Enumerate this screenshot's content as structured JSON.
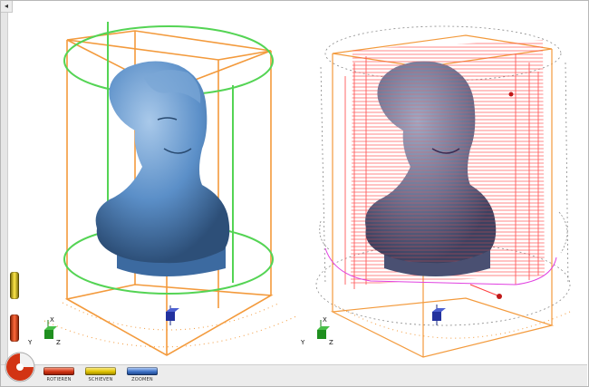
{
  "window": {
    "collapse_glyph": "◂"
  },
  "viewport": {
    "left_scene": {
      "object": "bust-model",
      "bounding_shape": "cylinder",
      "box_color": "#f39a3c",
      "cylinder_color": "#54d454"
    },
    "right_scene": {
      "object": "bust-model-toolpath",
      "toolpath_color": "#ff4040",
      "retract_color": "#e040e0"
    },
    "axis_triad": {
      "x": "X",
      "y": "Y",
      "z": "Z"
    }
  },
  "toolbar": {
    "buttons": [
      {
        "label": "ROTIEREN",
        "color": "#d23414"
      },
      {
        "label": "SCHIEVEN",
        "color": "#e2c400"
      },
      {
        "label": "ZOOMEN",
        "color": "#3e73c8"
      }
    ]
  },
  "side_controls": [
    {
      "name": "yellow-toggle",
      "color": "#ffe84a"
    },
    {
      "name": "red-toggle",
      "color": "#ff6a3c"
    }
  ]
}
